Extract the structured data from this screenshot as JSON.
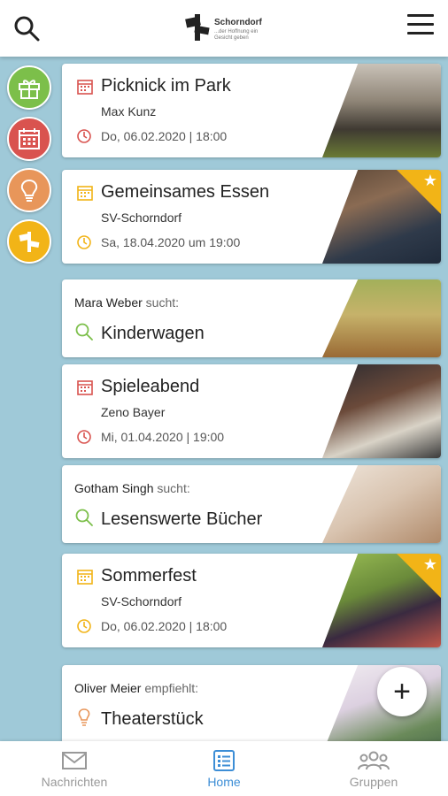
{
  "header": {
    "search_icon": "search-icon",
    "logo_text": "Schorndorf",
    "logo_sub": "...der Hoffnung ein Gesicht geben",
    "menu_icon": "hamburger-menu-icon"
  },
  "sidebar": [
    {
      "icon": "gift-icon",
      "color": "#7cbf4a"
    },
    {
      "icon": "calendar-icon",
      "color": "#d9534f"
    },
    {
      "icon": "lightbulb-icon",
      "color": "#e8965a"
    },
    {
      "icon": "flag-icon",
      "color": "#f2b417"
    }
  ],
  "cards": [
    {
      "type": "event",
      "title": "Picknick im Park",
      "org": "Max Kunz",
      "date": "Do, 06.02.2020 | 18:00",
      "accent": "#d9534f",
      "starred": false
    },
    {
      "type": "event",
      "title": "Gemeinsames Essen",
      "org": "SV-Schorndorf",
      "date": "Sa, 18.04.2020 um 19:00",
      "accent": "#f2b417",
      "starred": true
    },
    {
      "type": "search",
      "who": "Mara Weber",
      "verb": "sucht:",
      "what": "Kinderwagen",
      "accent": "#7cbf4a"
    },
    {
      "type": "event",
      "title": "Spieleabend",
      "org": "Zeno Bayer",
      "date": "Mi, 01.04.2020 | 19:00",
      "accent": "#d9534f",
      "starred": false
    },
    {
      "type": "search",
      "who": "Gotham Singh",
      "verb": "sucht:",
      "what": "Lesenswerte Bücher",
      "accent": "#7cbf4a"
    },
    {
      "type": "event",
      "title": "Sommerfest",
      "org": "SV-Schorndorf",
      "date": "Do, 06.02.2020 | 18:00",
      "accent": "#f2b417",
      "starred": true
    },
    {
      "type": "recommend",
      "who": "Oliver Meier",
      "verb": "empfiehlt:",
      "what": "Theaterstück",
      "accent": "#e8965a"
    }
  ],
  "fab": {
    "label": "+"
  },
  "nav": {
    "messages": "Nachrichten",
    "home": "Home",
    "groups": "Gruppen"
  }
}
